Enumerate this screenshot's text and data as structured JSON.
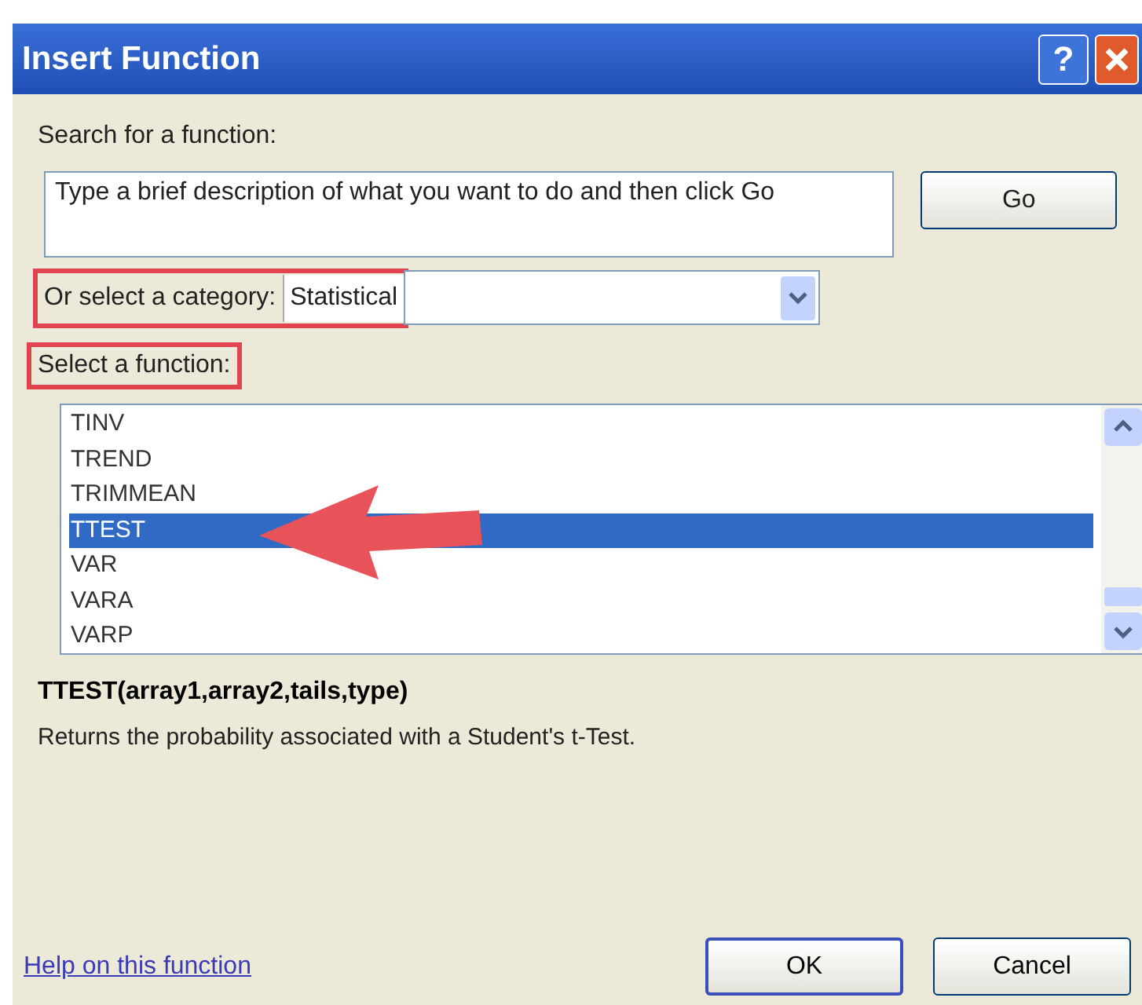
{
  "window": {
    "title": "Insert Function",
    "buttons": [
      "?"
    ]
  },
  "search": {
    "label": "Search for a function:",
    "value": "Type a brief description of what you want to do and then click Go",
    "button": "Go"
  },
  "category": {
    "label": "Or select a category:",
    "value": "Statistical",
    "highlighted": true
  },
  "function_list": {
    "label": "Select a function:",
    "highlighted": true,
    "items": [
      {
        "name": "TINV",
        "selected": false
      },
      {
        "name": "TREND",
        "selected": false
      },
      {
        "name": "TRIMMEAN",
        "selected": false
      },
      {
        "name": "TTEST",
        "selected": true
      },
      {
        "name": "VAR",
        "selected": false
      },
      {
        "name": "VARA",
        "selected": false
      },
      {
        "name": "VARP",
        "selected": false
      }
    ]
  },
  "signature": "TTEST(array1,array2,tails,type)",
  "description": "Returns the probability associated with a Student's t-Test.",
  "help_link": "Help on this function",
  "buttons": [
    {
      "label": "OK",
      "kind": "default"
    },
    {
      "label": "Cancel",
      "kind": "normal"
    }
  ]
}
